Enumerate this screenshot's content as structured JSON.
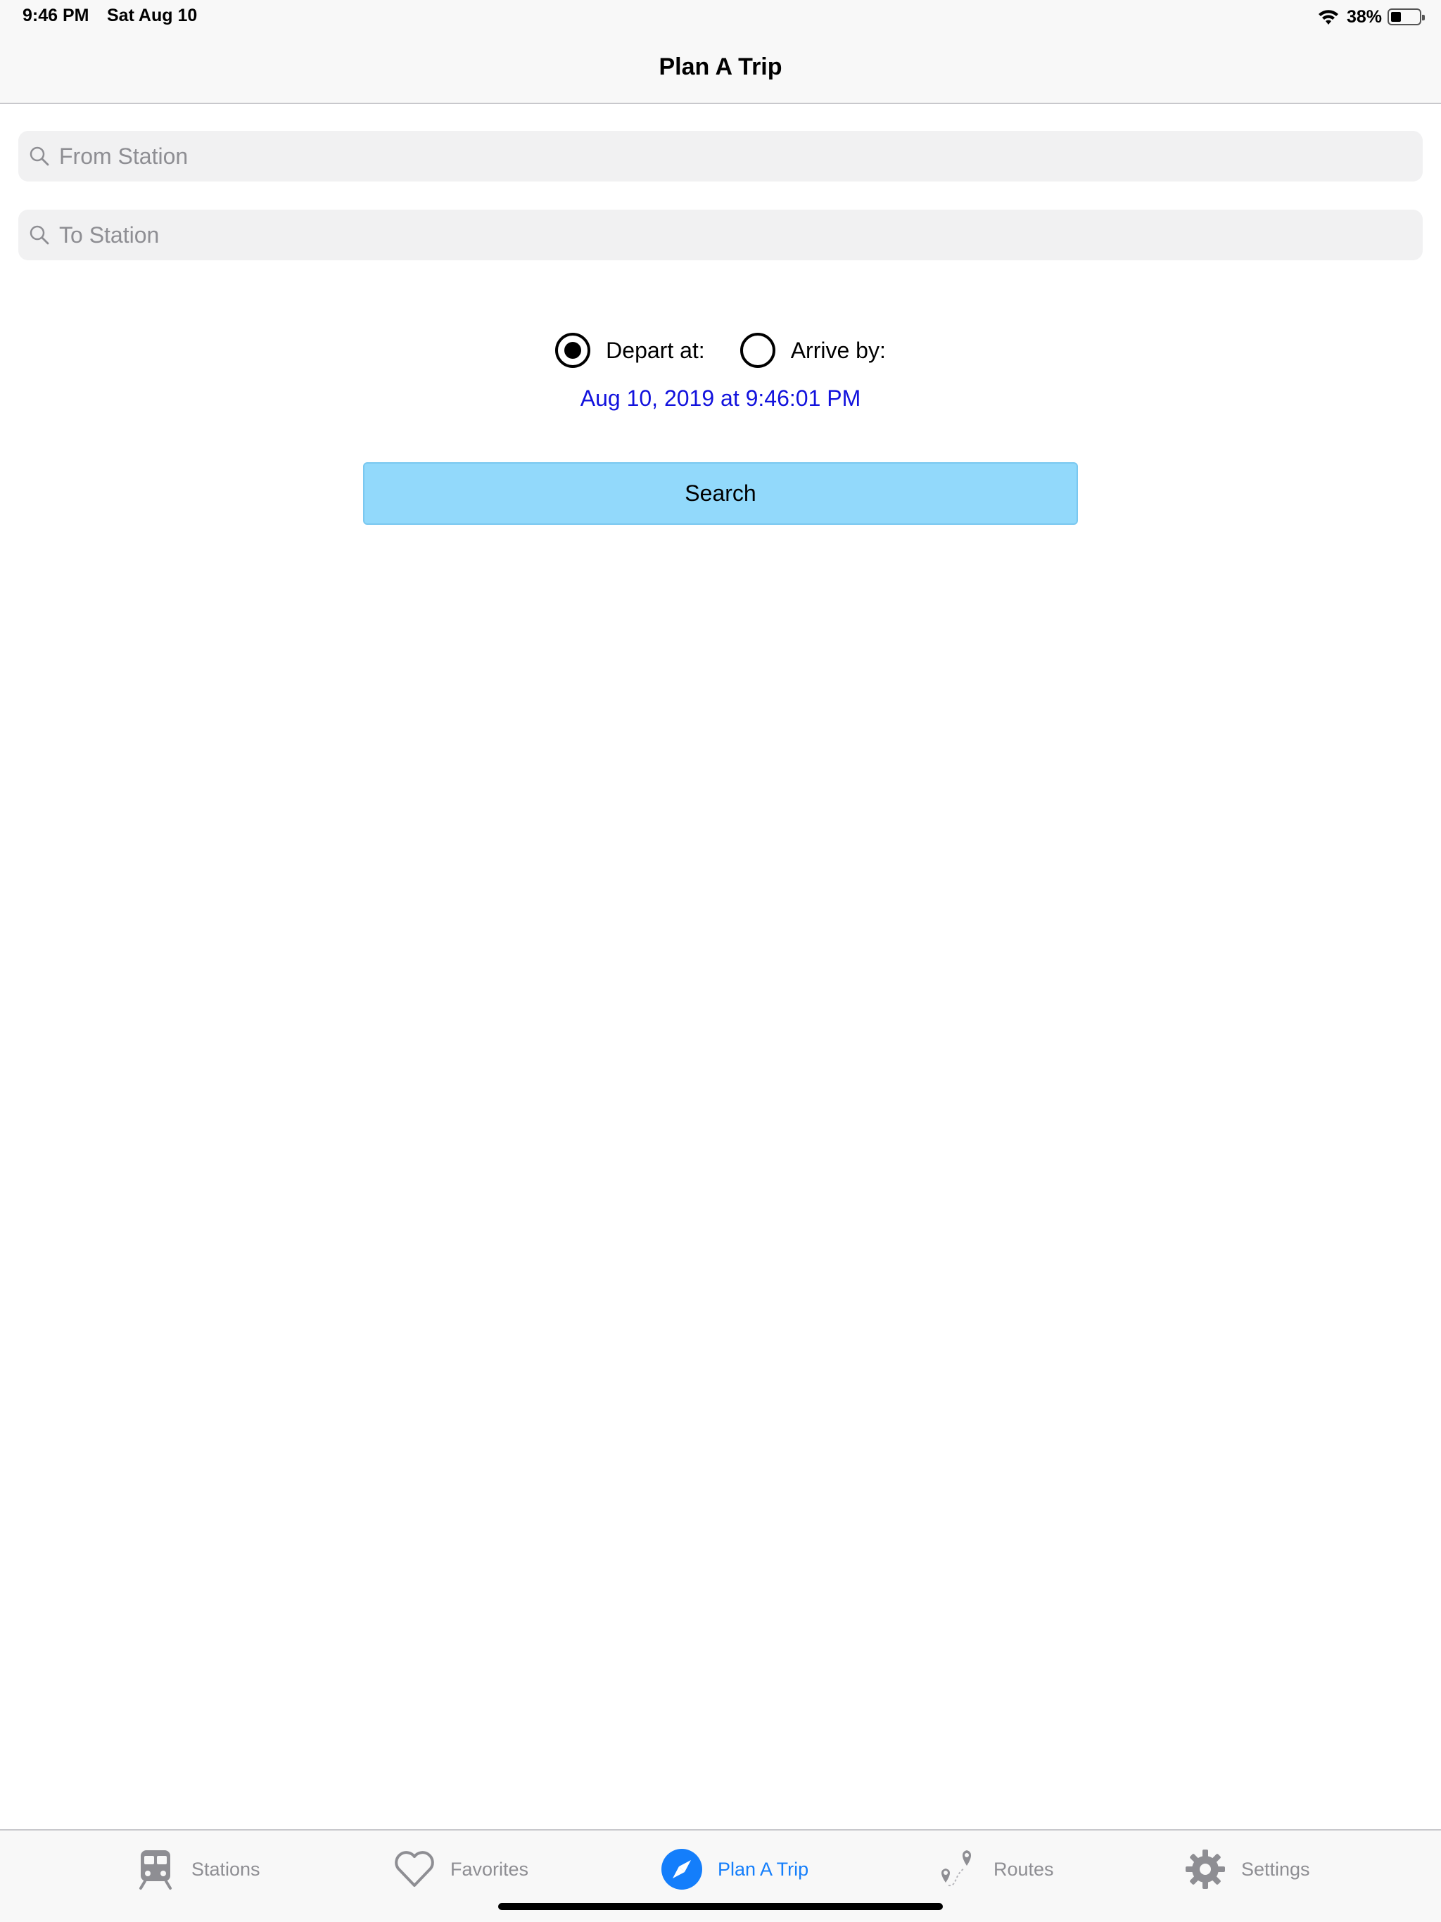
{
  "status_bar": {
    "time": "9:46 PM",
    "date": "Sat Aug 10",
    "battery_percent": "38%",
    "battery_level": 0.38,
    "icons": [
      "wifi-icon",
      "battery-icon"
    ]
  },
  "nav": {
    "title": "Plan A Trip"
  },
  "form": {
    "from_placeholder": "From Station",
    "from_value": "",
    "to_placeholder": "To Station",
    "to_value": "",
    "depart_label": "Depart at:",
    "arrive_label": "Arrive by:",
    "selected_mode": "depart",
    "datetime": "Aug 10, 2019 at 9:46:01 PM",
    "search_label": "Search"
  },
  "tabs": [
    {
      "label": "Stations",
      "icon": "train-icon",
      "active": false
    },
    {
      "label": "Favorites",
      "icon": "heart-icon",
      "active": false
    },
    {
      "label": "Plan A Trip",
      "icon": "compass-icon",
      "active": true
    },
    {
      "label": "Routes",
      "icon": "route-pins-icon",
      "active": false
    },
    {
      "label": "Settings",
      "icon": "gear-icon",
      "active": false
    }
  ],
  "colors": {
    "accent": "#147efb",
    "date_link": "#1212dd",
    "search_button": "#92d9fb",
    "inactive_tab": "#8e8e93"
  }
}
